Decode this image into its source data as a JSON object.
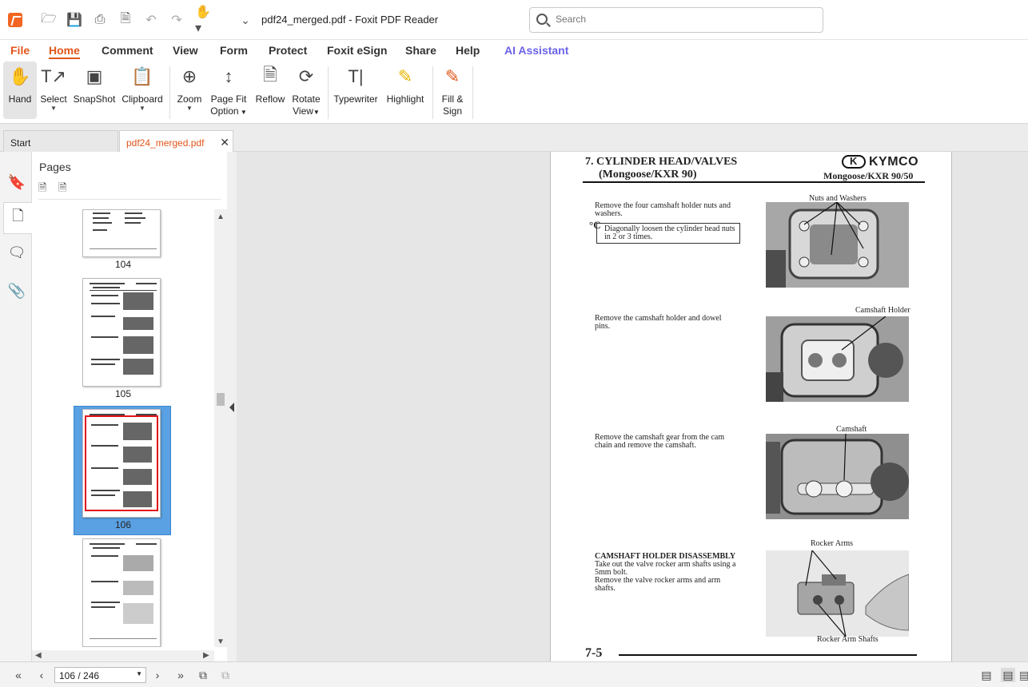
{
  "window": {
    "title": "pdf24_merged.pdf - Foxit PDF Reader"
  },
  "search": {
    "placeholder": "Search"
  },
  "menu": {
    "file": "File",
    "home": "Home",
    "comment": "Comment",
    "view": "View",
    "form": "Form",
    "protect": "Protect",
    "esign": "Foxit eSign",
    "share": "Share",
    "help": "Help",
    "ai": "AI Assistant"
  },
  "ribbon": {
    "hand": "Hand",
    "select": "Select",
    "snapshot": "SnapShot",
    "clipboard": "Clipboard",
    "zoom": "Zoom",
    "pagefit_1": "Page Fit",
    "pagefit_2": "Option",
    "reflow": "Reflow",
    "rotate_1": "Rotate",
    "rotate_2": "View",
    "typewriter": "Typewriter",
    "highlight": "Highlight",
    "fill_1": "Fill &",
    "fill_2": "Sign"
  },
  "tabs": {
    "start": "Start",
    "doc": "pdf24_merged.pdf"
  },
  "pages_panel": {
    "title": "Pages",
    "thumbs": [
      {
        "label": "104"
      },
      {
        "label": "105"
      },
      {
        "label": "106"
      }
    ]
  },
  "status": {
    "page_field": "106 / 246"
  },
  "document": {
    "heading_1": "7. CYLINDER HEAD/VALVES",
    "heading_2": "(Mongoose/KXR 90)",
    "brand": "KYMCO",
    "model": "Mongoose/KXR 90/50",
    "step1_a": "Remove the four camshaft holder nuts and",
    "step1_b": "washers.",
    "note_a": "Diagonally loosen the cylinder head nuts",
    "note_b": "in 2 or 3 times.",
    "symbol": "°C",
    "cap1": "Nuts and Washers",
    "step2_a": "Remove the camshaft holder and dowel",
    "step2_b": "pins.",
    "cap2": "Camshaft Holder",
    "step3_a": "Remove the camshaft gear from the cam",
    "step3_b": "chain and remove the camshaft.",
    "cap3": "Camshaft",
    "section": "CAMSHAFT HOLDER DISASSEMBLY",
    "step4_a": "Take out the valve rocker arm shafts using a",
    "step4_b": "5mm bolt.",
    "step4_c": "Remove the valve rocker arms and arm",
    "step4_d": "shafts.",
    "cap4a": "Rocker Arms",
    "cap4b": "Rocker Arm Shafts",
    "page_number": "7-5"
  }
}
